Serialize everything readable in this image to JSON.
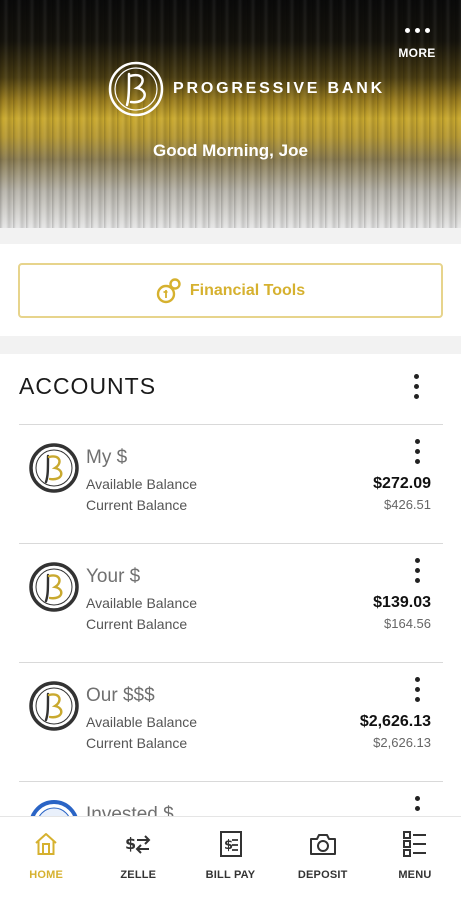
{
  "header": {
    "more_label": "MORE",
    "bank_name": "PROGRESSIVE BANK",
    "greeting": "Good Morning, Joe"
  },
  "tools": {
    "label": "Financial Tools"
  },
  "accounts": {
    "title": "ACCOUNTS",
    "items": [
      {
        "name": "My $",
        "available_label": "Available Balance",
        "current_label": "Current Balance",
        "available": "$272.09",
        "current": "$426.51"
      },
      {
        "name": "Your $",
        "available_label": "Available Balance",
        "current_label": "Current Balance",
        "available": "$139.03",
        "current": "$164.56"
      },
      {
        "name": "Our $$$",
        "available_label": "Available Balance",
        "current_label": "Current Balance",
        "available": "$2,626.13",
        "current": "$2,626.13"
      },
      {
        "name": "Invested $"
      }
    ]
  },
  "nav": {
    "items": [
      {
        "label": "HOME",
        "icon": "home-icon",
        "active": true
      },
      {
        "label": "ZELLE",
        "icon": "transfer-icon",
        "active": false
      },
      {
        "label": "BILL PAY",
        "icon": "bill-icon",
        "active": false
      },
      {
        "label": "DEPOSIT",
        "icon": "camera-icon",
        "active": false
      },
      {
        "label": "MENU",
        "icon": "menu-list-icon",
        "active": false
      }
    ]
  },
  "colors": {
    "accent": "#d6b12f",
    "accent_border": "#e7d48c",
    "text_dark": "#111111",
    "divider": "#d9d9d9"
  }
}
